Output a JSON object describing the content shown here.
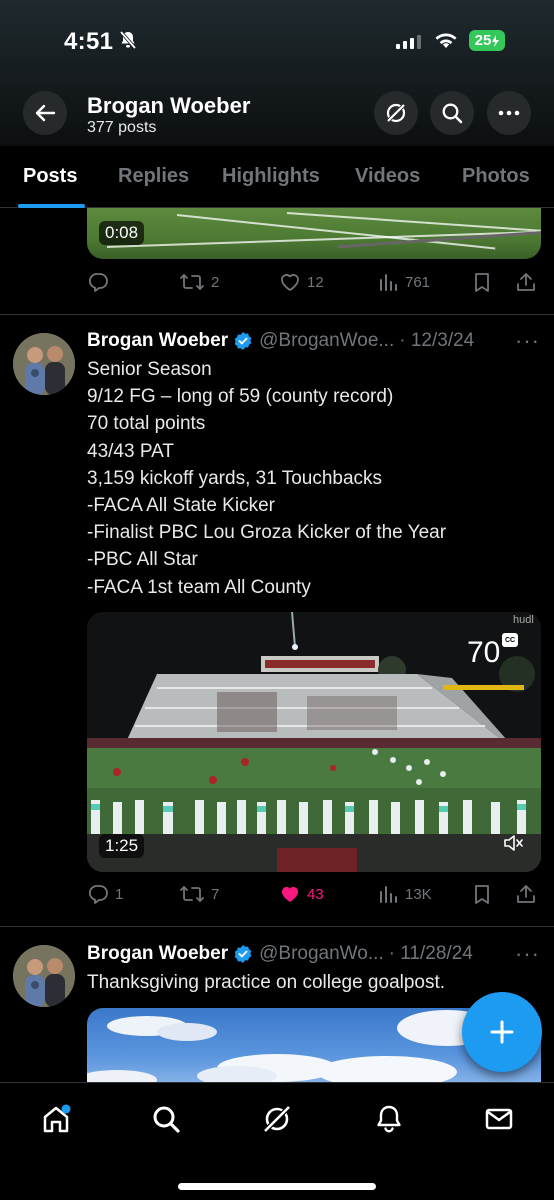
{
  "status_bar": {
    "time": "4:51",
    "battery": "25"
  },
  "profile_header": {
    "name": "Brogan Woeber",
    "post_count": "377 posts"
  },
  "tabs": [
    {
      "label": "Posts",
      "active": true
    },
    {
      "label": "Replies",
      "active": false
    },
    {
      "label": "Highlights",
      "active": false
    },
    {
      "label": "Videos",
      "active": false
    },
    {
      "label": "Photos",
      "active": false
    }
  ],
  "posts": [
    {
      "video_duration": "0:08",
      "replies": "",
      "reposts": "2",
      "likes": "12",
      "views": "761"
    },
    {
      "author": "Brogan Woeber",
      "handle": "@BroganWoe...",
      "date": "· 12/3/24",
      "text": "Senior Season\n9/12 FG – long of 59 (county record)\n70 total points\n43/43 PAT\n3,159 kickoff yards, 31 Touchbacks\n-FACA All State Kicker\n-Finalist PBC Lou Groza Kicker of the Year\n-PBC All Star\n-FACA 1st team All County",
      "video": {
        "duration": "1:25",
        "scoreboard_number": "70",
        "cc_label": "CC",
        "watermark": "hudl"
      },
      "replies": "1",
      "reposts": "7",
      "likes": "43",
      "liked": true,
      "views": "13K"
    },
    {
      "author": "Brogan Woeber",
      "handle": "@BroganWo...",
      "date": "· 11/28/24",
      "text": "Thanksgiving practice on college goalpost."
    }
  ],
  "colors": {
    "accent": "#1d9bf0",
    "like": "#f91880",
    "muted": "#71767b",
    "battery": "#34c759"
  },
  "icons": {
    "back": "arrow-left-icon",
    "grok": "grok-icon",
    "search": "search-icon",
    "more": "more-icon",
    "reply": "reply-icon",
    "repost": "repost-icon",
    "like": "heart-icon",
    "views": "views-icon",
    "bookmark": "bookmark-icon",
    "share": "share-icon",
    "verified": "verified-badge-icon",
    "compose": "plus-icon",
    "nav": [
      "home-icon",
      "search-icon",
      "grok-icon",
      "bell-icon",
      "mail-icon"
    ]
  }
}
